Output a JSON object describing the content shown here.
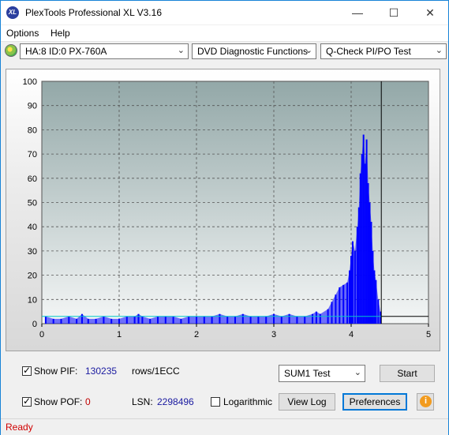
{
  "window": {
    "title": "PlexTools Professional XL V3.16",
    "icon_text": "XL"
  },
  "menu": [
    {
      "label": "Options"
    },
    {
      "label": "Help"
    }
  ],
  "toolbar": {
    "drive": "HA:8 ID:0  PX-760A",
    "function": "DVD Diagnostic Functions",
    "test": "Q-Check PI/PO Test"
  },
  "chart_data": {
    "type": "bar",
    "xlim": [
      0,
      5
    ],
    "ylim": [
      0,
      100
    ],
    "x_ticks": [
      "0",
      "1",
      "2",
      "3",
      "4",
      "5"
    ],
    "y_ticks": [
      "0",
      "10",
      "20",
      "30",
      "40",
      "50",
      "60",
      "70",
      "80",
      "90",
      "100"
    ],
    "grid": true,
    "data_end_x": 4.39,
    "baseline_level": 3,
    "series": [
      {
        "color": "#0000ff",
        "x": [
          0.05,
          0.15,
          0.25,
          0.35,
          0.45,
          0.52,
          0.6,
          0.7,
          0.8,
          0.9,
          1.0,
          1.1,
          1.2,
          1.25,
          1.3,
          1.4,
          1.5,
          1.6,
          1.7,
          1.8,
          1.9,
          2.0,
          2.1,
          2.2,
          2.3,
          2.4,
          2.5,
          2.6,
          2.7,
          2.8,
          2.9,
          3.0,
          3.1,
          3.2,
          3.3,
          3.4,
          3.5,
          3.55,
          3.6,
          3.7,
          3.75,
          3.8,
          3.85,
          3.9,
          3.95,
          3.98,
          4.0,
          4.02,
          4.05,
          4.08,
          4.1,
          4.12,
          4.14,
          4.16,
          4.18,
          4.2,
          4.22,
          4.24,
          4.26,
          4.28,
          4.3,
          4.32,
          4.35,
          4.38
        ],
        "y": [
          3,
          2,
          2,
          3,
          2,
          4,
          2,
          2,
          3,
          2,
          2,
          3,
          3,
          4,
          3,
          2,
          3,
          3,
          3,
          2,
          3,
          3,
          3,
          3,
          4,
          3,
          3,
          4,
          3,
          3,
          3,
          4,
          3,
          4,
          3,
          3,
          4,
          5,
          4,
          6,
          9,
          12,
          15,
          16,
          17,
          22,
          28,
          34,
          30,
          40,
          48,
          62,
          70,
          78,
          66,
          76,
          58,
          50,
          42,
          30,
          22,
          18,
          10,
          5
        ]
      }
    ]
  },
  "bottom": {
    "show_pif_label": "Show PIF:",
    "pif_value": "130235",
    "rows_label": "rows/1ECC",
    "show_pof_label": "Show POF:",
    "pof_value": "0",
    "lsn_label": "LSN:",
    "lsn_value": "2298496",
    "logarithmic_label": "Logarithmic",
    "sum_test": "SUM1 Test",
    "start_label": "Start",
    "view_log_label": "View Log",
    "preferences_label": "Preferences"
  },
  "status": "Ready",
  "colors": {
    "pif_value": "#1a1aa0",
    "pof_value": "#c00000",
    "status": "#d00000",
    "bar": "#0000ff"
  }
}
